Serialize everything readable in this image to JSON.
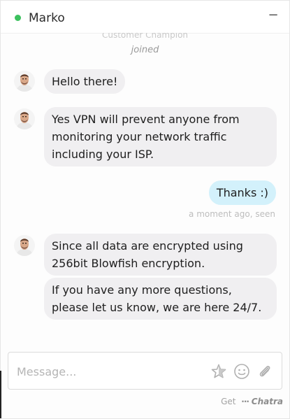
{
  "header": {
    "agent_name": "Marko",
    "minimize_label": "−",
    "status_color": "#3cc15e"
  },
  "system": {
    "agent_title": "Customer Champion",
    "joined_text": "joined"
  },
  "messages": [
    {
      "from": "agent",
      "text": "Hello there!"
    },
    {
      "from": "agent",
      "lines": [
        "Yes VPN will prevent anyone from",
        "monitoring your network traffic",
        "including your ISP."
      ]
    },
    {
      "from": "user",
      "text": "Thanks :)",
      "meta": "a moment ago, seen"
    },
    {
      "from": "agent",
      "lines": [
        "Since all data are encrypted using",
        "256bit Blowfish encryption."
      ]
    },
    {
      "from": "agent",
      "lines": [
        "If you have any more questions,",
        "please let us know, we are here 24/7."
      ]
    }
  ],
  "composer": {
    "placeholder": "Message...",
    "icons": [
      "star-icon",
      "smiley-icon",
      "paperclip-icon"
    ]
  },
  "footer": {
    "get_text": "Get",
    "brand": "Chatra"
  },
  "colors": {
    "agent_bubble": "#f0eff1",
    "user_bubble": "#d3f1fb"
  }
}
